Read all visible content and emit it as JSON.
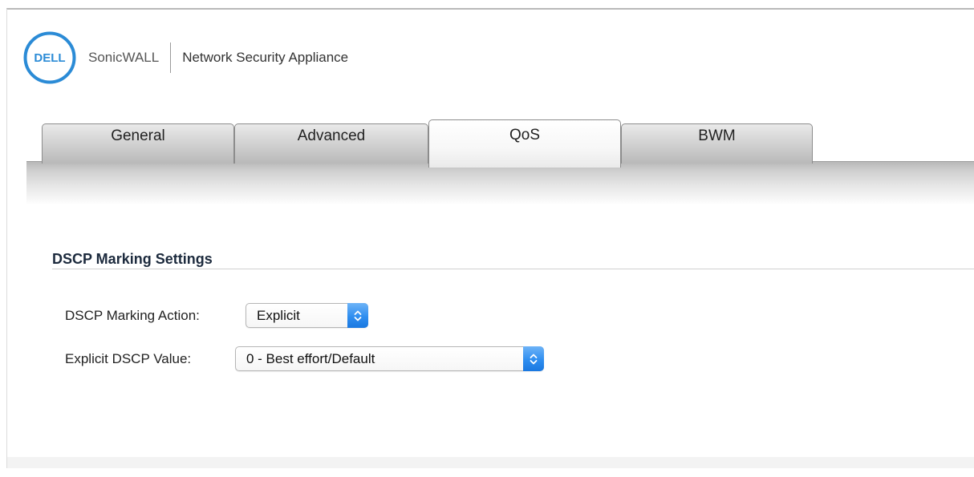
{
  "header": {
    "logo_text": "DELL",
    "brand": "SonicWALL",
    "product": "Network Security Appliance"
  },
  "tabs": [
    {
      "label": "General",
      "active": false
    },
    {
      "label": "Advanced",
      "active": false
    },
    {
      "label": "QoS",
      "active": true
    },
    {
      "label": "BWM",
      "active": false
    }
  ],
  "section": {
    "title": "DSCP Marking Settings"
  },
  "fields": {
    "marking_action": {
      "label": "DSCP Marking Action:",
      "value": "Explicit"
    },
    "explicit_value": {
      "label": "Explicit DSCP Value:",
      "value": "0 - Best effort/Default"
    }
  },
  "icons": {
    "logo": "dell-logo-icon",
    "dropdown": "chevron-up-down-icon"
  },
  "colors": {
    "dell_blue": "#2b8bd6",
    "select_accent": "#2f8ef0"
  }
}
